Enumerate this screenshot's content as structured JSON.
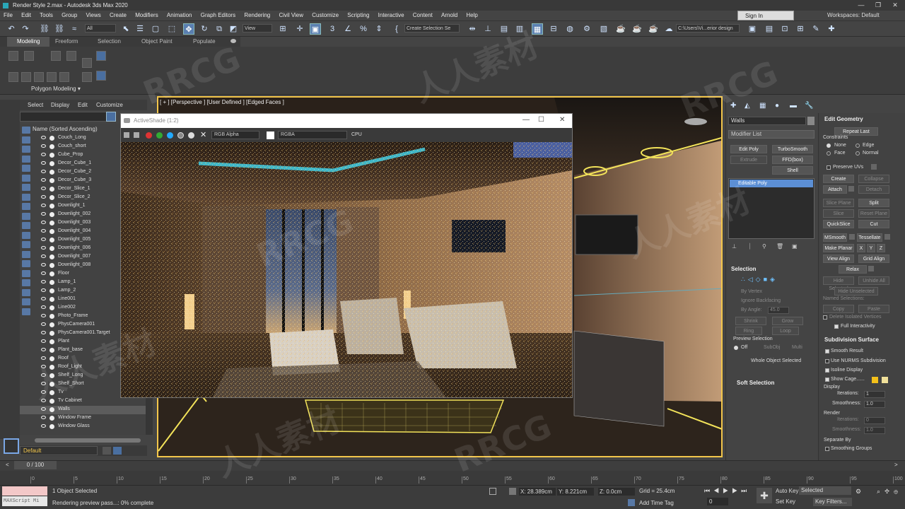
{
  "window": {
    "title": "Render Style 2.max - Autodesk 3ds Max 2020"
  },
  "menu": [
    "File",
    "Edit",
    "Tools",
    "Group",
    "Views",
    "Create",
    "Modifiers",
    "Animation",
    "Graph Editors",
    "Rendering",
    "Civil View",
    "Customize",
    "Scripting",
    "Interactive",
    "Content",
    "Arnold",
    "Help"
  ],
  "signin": "Sign In",
  "workspaces": "Workspaces: Default",
  "toolbar": {
    "filter": "All",
    "refcoord": "View",
    "selset": "Create Selection Se",
    "path": "C:\\Users\\Vi...erior design"
  },
  "ribbon": {
    "tabs": [
      "Modeling",
      "Freeform",
      "Selection",
      "Object Paint",
      "Populate"
    ],
    "panel": "Polygon Modeling ▾"
  },
  "scene_explorer": {
    "menu": [
      "Select",
      "Display",
      "Edit",
      "Customize"
    ],
    "header": "Name (Sorted Ascending)",
    "items": [
      "Couch_Long",
      "Couch_short",
      "Cube_Prop",
      "Decor_Cube_1",
      "Decor_Cube_2",
      "Decor_Cube_3",
      "Decor_Slice_1",
      "Decor_Slice_2",
      "Downlight_1",
      "Downlight_002",
      "Downlight_003",
      "Downlight_004",
      "Downlight_005",
      "Downlight_006",
      "Downlight_007",
      "Downlight_008",
      "Floor",
      "Lamp_1",
      "Lamp_2",
      "Line001",
      "Line002",
      "Photo_Frame",
      "PhysCamera001",
      "PhysCamera001.Target",
      "Plant",
      "Plant_base",
      "Roof",
      "Roof_Light",
      "Shelf_Long",
      "Shelf_Short",
      "Tv",
      "Tv Cabinet",
      "Walls",
      "Window Frame",
      "Window Glass"
    ],
    "selected": "Walls",
    "layer": "Default"
  },
  "viewport": {
    "label": "[ + ] [Perspective ] [User Defined ] [Edged Faces ]"
  },
  "activeshade": {
    "title": "ActiveShade (1:2)",
    "channel": "RGB Alpha",
    "mode": "RGBA",
    "device": "CPU"
  },
  "command_panel": {
    "object_name": "Walls",
    "modifier_list": "Modifier List",
    "buttons": [
      "Edit Poly",
      "TurboSmooth",
      "Extrude",
      "FFD(box)",
      "Shell"
    ],
    "stack_item": "Editable Poly",
    "selection": {
      "title": "Selection",
      "by_vertex": "By Vertex",
      "ignore_backfacing": "Ignore Backfacing",
      "by_angle": "By Angle:",
      "angle": "45.0",
      "shrink": "Shrink",
      "grow": "Grow",
      "ring": "Ring",
      "loop": "Loop",
      "preview": "Preview Selection",
      "off": "Off",
      "subobj": "SubObj",
      "multi": "Multi",
      "whole": "Whole Object Selected"
    },
    "soft_selection": "Soft Selection"
  },
  "edit_geometry": {
    "title": "Edit Geometry",
    "repeat_last": "Repeat Last",
    "constraints": "Constraints",
    "none": "None",
    "edge": "Edge",
    "face": "Face",
    "normal": "Normal",
    "preserve_uvs": "Preserve UVs",
    "create": "Create",
    "collapse": "Collapse",
    "attach": "Attach",
    "detach": "Detach",
    "slice_plane": "Slice Plane",
    "split": "Split",
    "slice": "Slice",
    "reset_plane": "Reset Plane",
    "quickslice": "QuickSlice",
    "cut": "Cut",
    "msmooth": "MSmooth",
    "tessellate": "Tessellate",
    "make_planar": "Make Planar",
    "x": "X",
    "y": "Y",
    "z": "Z",
    "view_align": "View Align",
    "grid_align": "Grid Align",
    "relax": "Relax",
    "hide_selected": "Hide Selected",
    "unhide_all": "Unhide All",
    "hide_unselected": "Hide Unselected",
    "named_selections": "Named Selections:",
    "copy": "Copy",
    "paste": "Paste",
    "delete_isolated": "Delete Isolated Vertices",
    "full_interactivity": "Full Interactivity"
  },
  "subdivision": {
    "title": "Subdivision Surface",
    "smooth_result": "Smooth Result",
    "use_nurms": "Use NURMS Subdivision",
    "isoline": "Isoline Display",
    "show_cage": "Show Cage......",
    "display": "Display",
    "iterations": "Iterations:",
    "iterations_val": "1",
    "smoothness": "Smoothness:",
    "smoothness_val": "1.0",
    "render": "Render",
    "r_iterations": "Iterations:",
    "r_iterations_val": "0",
    "r_smoothness": "Smoothness:",
    "r_smoothness_val": "1.0",
    "separate_by": "Separate By",
    "smoothing_groups": "Smoothing Groups"
  },
  "timeline": {
    "frame": "0 / 100",
    "ticks": [
      "0",
      "5",
      "10",
      "15",
      "20",
      "25",
      "30",
      "35",
      "40",
      "45",
      "50",
      "55",
      "60",
      "65",
      "70",
      "75",
      "80",
      "85",
      "90",
      "95",
      "100"
    ]
  },
  "status": {
    "selected": "1 Object Selected",
    "render": "Rendering preview pass...: 0% complete",
    "x": "X: 28.389cm",
    "y": "Y: 8.221cm",
    "z": "Z: 0.0cm",
    "grid": "Grid = 25.4cm",
    "add_time_tag": "Add Time Tag",
    "auto_key": "Auto Key",
    "set_key": "Set Key",
    "selected_dd": "Selected",
    "key_filters": "Key Filters...",
    "maxscript": "MAXScript Mi"
  },
  "watermarks": [
    "RRCG",
    "人人素材",
    "RRCG",
    "人人素材",
    "RRCG",
    "人人素材",
    "RRCG",
    "人人素材"
  ]
}
